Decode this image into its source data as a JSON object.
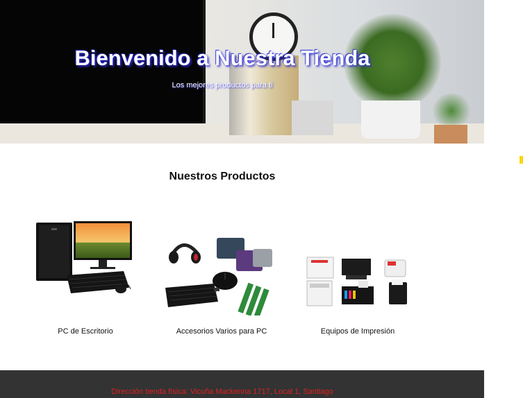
{
  "hero": {
    "title": "Bienvenido a Nuestra Tienda",
    "subtitle": "Los mejores productos para ti",
    "image": "office-desk-photo"
  },
  "products_section": {
    "title": "Nuestros Productos",
    "items": [
      {
        "label": "PC de Escritorio",
        "image": "desktop-pc-image"
      },
      {
        "label": "Accesorios Varios para PC",
        "image": "pc-accessories-image"
      },
      {
        "label": "Equipos de Impresión",
        "image": "printers-image"
      }
    ]
  },
  "footer": {
    "address": "Dirección tienda física: Vicuña Mackenna 1717, Local 1, Santiago"
  },
  "colors": {
    "hero_text_shadow": "#2b2bd6",
    "footer_bg": "#333333",
    "footer_text": "#e02020"
  }
}
